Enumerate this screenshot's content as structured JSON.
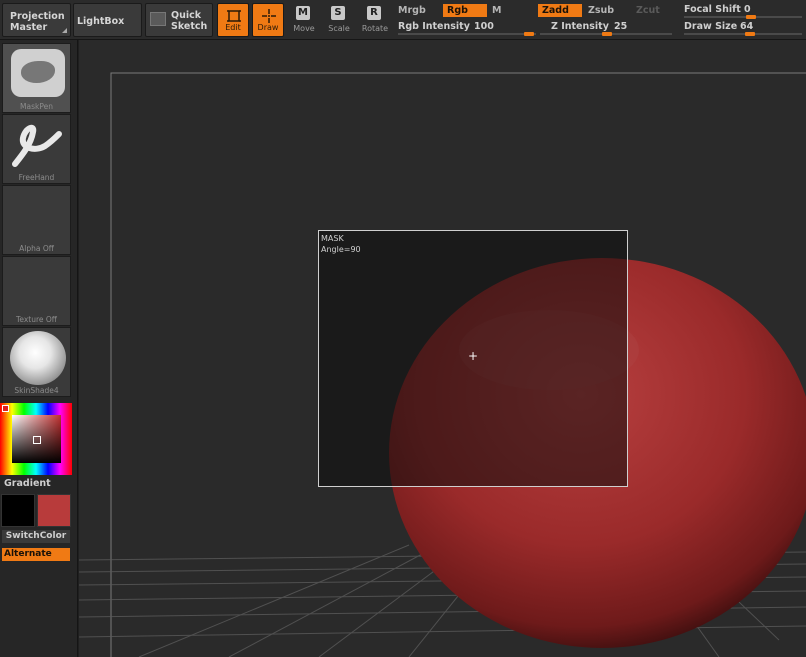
{
  "toolbar": {
    "projection_master": "Projection Master",
    "lightbox": "LightBox",
    "quick_sketch": "Quick Sketch",
    "edit": "Edit",
    "draw": "Draw",
    "move": "Move",
    "scale": "Scale",
    "rotate": "Rotate",
    "move_key": "M",
    "scale_key": "S",
    "rotate_key": "R",
    "mrgb": "Mrgb",
    "rgb": "Rgb",
    "m": "M",
    "zadd": "Zadd",
    "zsub": "Zsub",
    "zcut": "Zcut",
    "rgb_intensity_label": "Rgb Intensity",
    "rgb_intensity_value": "100",
    "z_intensity_label": "Z Intensity",
    "z_intensity_value": "25",
    "focal_shift_label": "Focal Shift",
    "focal_shift_value": "0",
    "draw_size_label": "Draw Size",
    "draw_size_value": "64"
  },
  "left_panel": {
    "brush_label": "MaskPen",
    "stroke_label": "FreeHand",
    "alpha_label": "Alpha  Off",
    "texture_label": "Texture  Off",
    "material_label": "SkinShade4",
    "gradient_label": "Gradient",
    "switchcolor_label": "SwitchColor",
    "alternate_label": "Alternate",
    "primary_color": "#000000",
    "secondary_color": "#b83b3b"
  },
  "canvas": {
    "mask_title": "MASK",
    "mask_angle": "Angle=90",
    "sphere_color": "#a83030",
    "accent_color": "#f07a14"
  }
}
